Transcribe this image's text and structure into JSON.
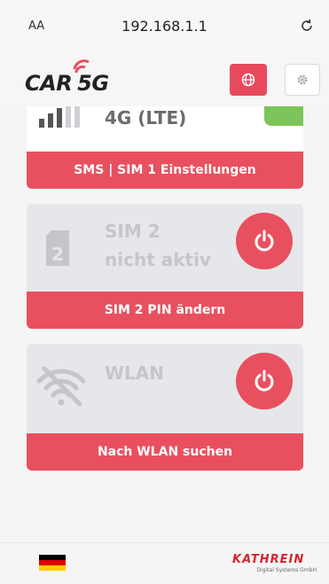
{
  "browser": {
    "text_size_label": "AA",
    "url": "192.168.1.1"
  },
  "header": {
    "logo_text_car": "CAR",
    "logo_text_5g": "5G"
  },
  "sim1_card": {
    "network_label": "4G (LTE)",
    "footer_button": "SMS | SIM 1 Einstellungen"
  },
  "sim2_card": {
    "slot_number": "2",
    "title_line1": "SIM 2",
    "title_line2": "nicht aktiv",
    "footer_button": "SIM 2 PIN ändern"
  },
  "wlan_card": {
    "title": "WLAN",
    "footer_button": "Nach WLAN suchen"
  },
  "footer": {
    "brand": "KATHREIN",
    "brand_sub": "Digital Systems GmbH"
  },
  "colors": {
    "accent": "#e9505f",
    "active_green": "#7dc45a"
  }
}
